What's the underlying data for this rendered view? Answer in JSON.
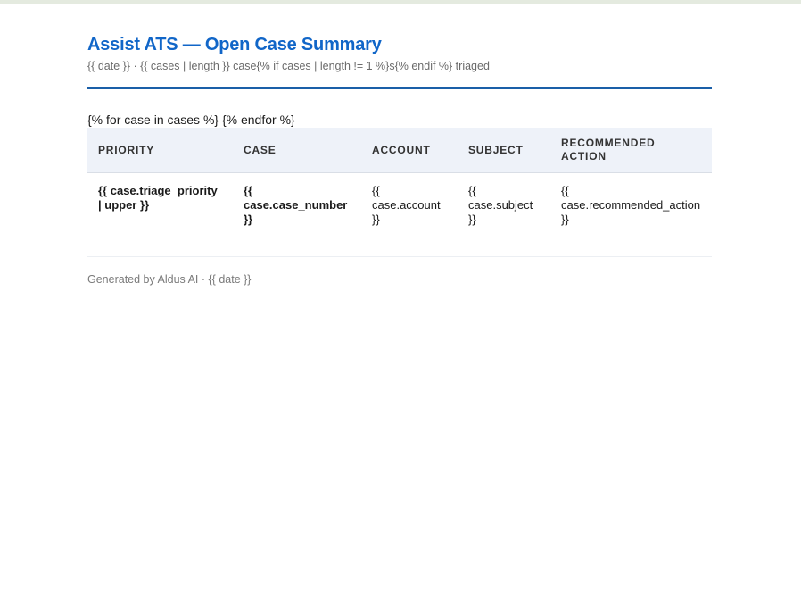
{
  "header": {
    "title": "Assist ATS — Open Case Summary",
    "subtitle": "{{ date }}  ·  {{ cases | length }} case{% if cases | length != 1 %}s{% endif %} triaged"
  },
  "loop_text": "{% for case in cases %} {% endfor %}",
  "table": {
    "columns": [
      "PRIORITY",
      "CASE",
      "ACCOUNT",
      "SUBJECT",
      "RECOMMENDED ACTION"
    ],
    "rows": [
      {
        "priority": "{{ case.triage_priority | upper }}",
        "case_number": "{{ case.case_number }}",
        "account": "{{ case.account }}",
        "subject": "{{ case.subject }}",
        "recommended_action": "{{ case.recommended_action }}"
      }
    ]
  },
  "footer": {
    "text": "Generated by Aldus AI  ·  {{ date }}"
  },
  "colors": {
    "accent": "#1166c8",
    "rule": "#1a5fa8",
    "header_bg": "#eef2f9"
  }
}
